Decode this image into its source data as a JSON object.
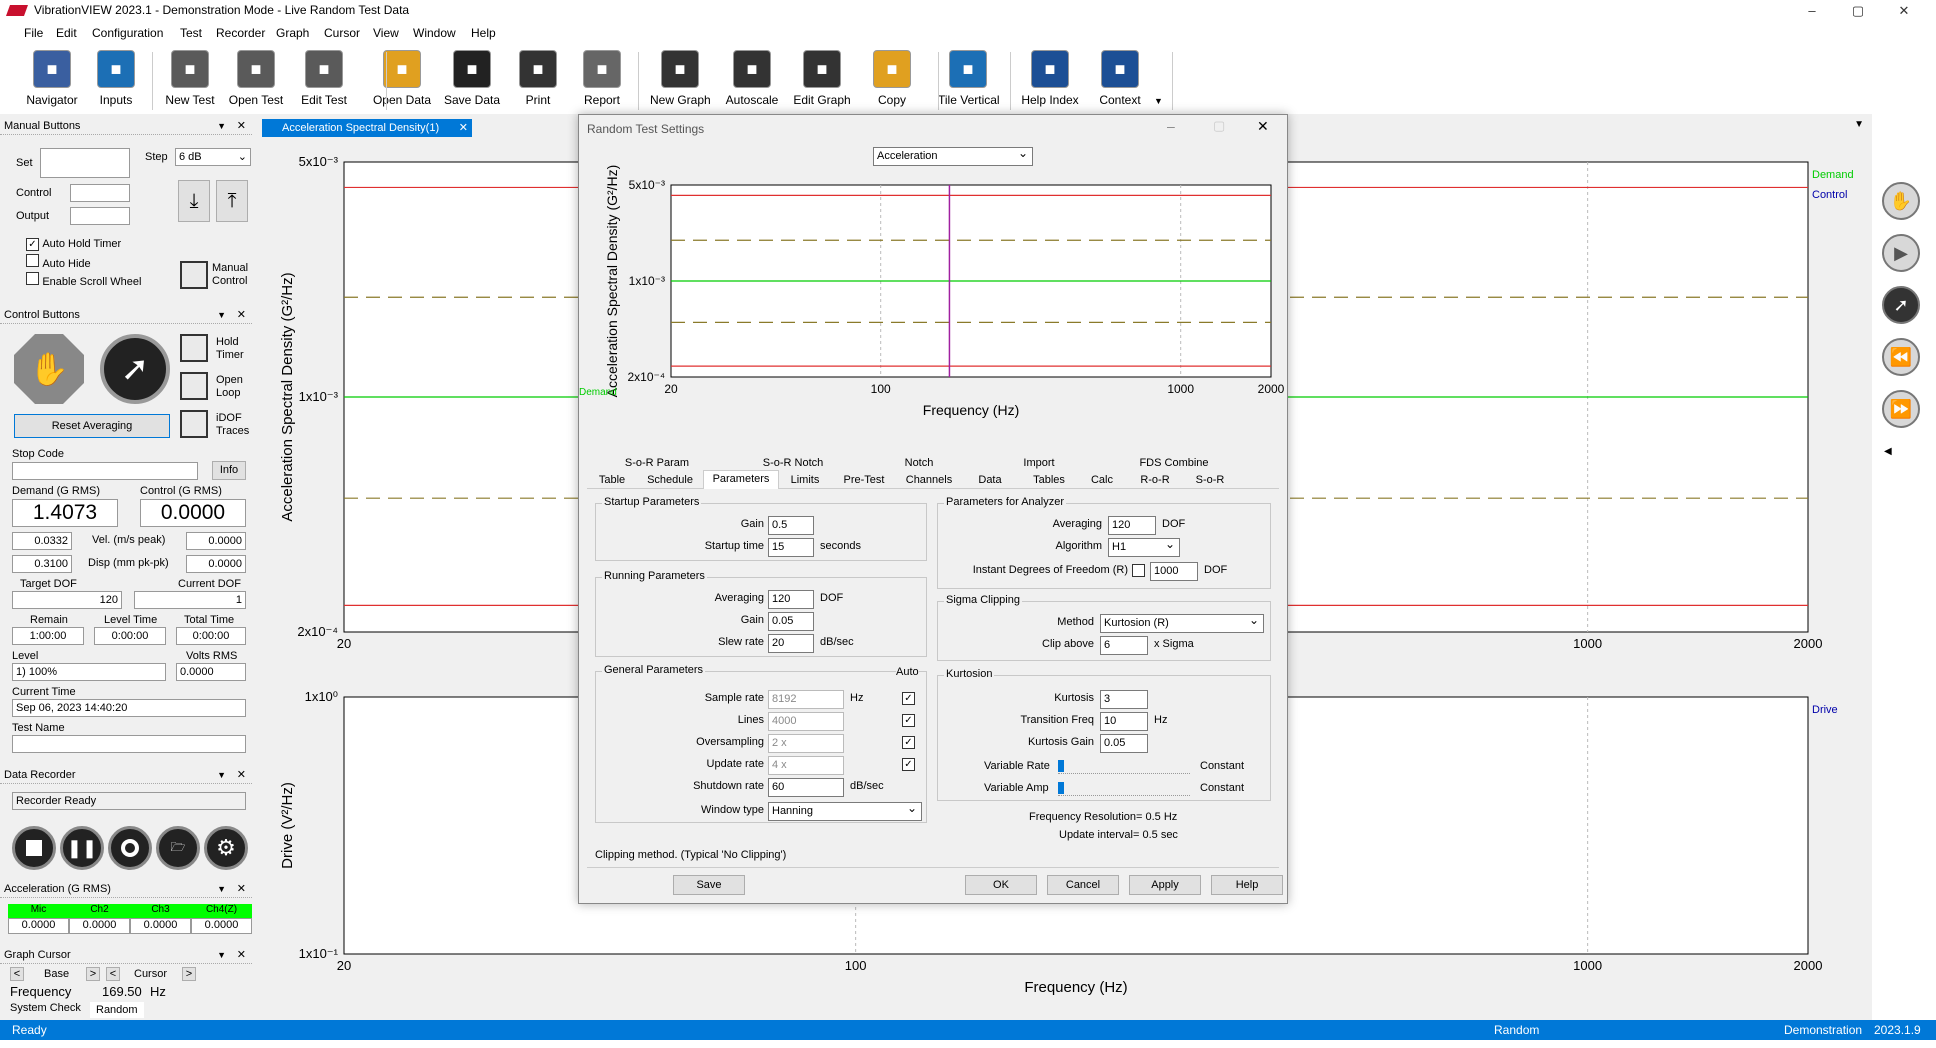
{
  "window": {
    "title": "VibrationVIEW 2023.1 - Demonstration Mode - Live Random Test Data",
    "min": "–",
    "max": "▢",
    "close": "✕"
  },
  "menu": [
    "File",
    "Edit",
    "Configuration",
    "Test",
    "Recorder",
    "Graph",
    "Cursor",
    "View",
    "Window",
    "Help"
  ],
  "toolbar": [
    {
      "label": "Navigator",
      "icon": "navigator-icon",
      "color": "#3a5fa0"
    },
    {
      "label": "Inputs",
      "icon": "inputs-icon",
      "color": "#1c6fb5"
    },
    {
      "label": "New Test",
      "icon": "gear-plus-icon",
      "color": "#5a5a5a"
    },
    {
      "label": "Open Test",
      "icon": "gear-open-icon",
      "color": "#5a5a5a"
    },
    {
      "label": "Edit Test",
      "icon": "gear-edit-icon",
      "color": "#5a5a5a"
    },
    {
      "label": "Open Data",
      "icon": "folder-icon",
      "color": "#e0a020"
    },
    {
      "label": "Save Data",
      "icon": "floppy-icon",
      "color": "#222"
    },
    {
      "label": "Print",
      "icon": "printer-icon",
      "color": "#333"
    },
    {
      "label": "Report",
      "icon": "report-icon",
      "color": "#666"
    },
    {
      "label": "New Graph",
      "icon": "new-graph-icon",
      "color": "#333"
    },
    {
      "label": "Autoscale",
      "icon": "autoscale-icon",
      "color": "#333"
    },
    {
      "label": "Edit Graph",
      "icon": "edit-graph-icon",
      "color": "#333"
    },
    {
      "label": "Copy",
      "icon": "copy-icon",
      "color": "#e0a020"
    },
    {
      "label": "Tile Vertical",
      "icon": "tile-vertical-icon",
      "color": "#1c6fb5"
    },
    {
      "label": "Help Index",
      "icon": "help-icon",
      "color": "#1c4f95"
    },
    {
      "label": "Context",
      "icon": "context-help-icon",
      "color": "#1c4f95"
    }
  ],
  "manual": {
    "header": "Manual Buttons",
    "set_label": "Set",
    "step_label": "Step",
    "step_value": "6 dB",
    "control_label": "Control",
    "output_label": "Output",
    "auto_hold": "Auto Hold Timer",
    "auto_hide": "Auto Hide",
    "scroll_wheel": "Enable Scroll Wheel",
    "manual_control": "Manual Control"
  },
  "control": {
    "header": "Control Buttons",
    "hold_timer": "Hold Timer",
    "open_loop": "Open Loop",
    "idof": "iDOF Traces",
    "reset": "Reset Averaging",
    "stop_code": "Stop Code",
    "info": "Info",
    "demand_label": "Demand (G RMS)",
    "control_label": "Control (G RMS)",
    "demand_value": "1.4073",
    "control_value": "0.0000",
    "v1": "0.0332",
    "vel_label": "Vel. (m/s peak)",
    "vel_value": "0.0000",
    "v2": "0.3100",
    "disp_label": "Disp (mm pk-pk)",
    "disp_value": "0.0000",
    "target_dof_label": "Target DOF",
    "current_dof_label": "Current DOF",
    "target_dof": "120",
    "current_dof": "1",
    "remain_label": "Remain",
    "level_time_label": "Level Time",
    "total_time_label": "Total Time",
    "remain": "1:00:00",
    "level_time": "0:00:00",
    "total_time": "0:00:00",
    "level_label": "Level",
    "volts_label": "Volts RMS",
    "level": "1) 100%",
    "volts": "0.0000",
    "current_time_label": "Current Time",
    "current_time": "Sep 06, 2023 14:40:20",
    "test_name_label": "Test Name"
  },
  "recorder": {
    "header": "Data Recorder",
    "status": "Recorder Ready"
  },
  "accel": {
    "header": "Acceleration (G RMS)",
    "channels": [
      "Mic",
      "Ch2",
      "Ch3",
      "Ch4(Z)"
    ],
    "values": [
      "0.0000",
      "0.0000",
      "0.0000",
      "0.0000"
    ]
  },
  "cursor": {
    "header": "Graph Cursor",
    "base": "Base",
    "cursor": "Cursor",
    "freq_label": "Frequency",
    "freq_value": "169.50",
    "freq_unit": "Hz"
  },
  "bottom_tabs": [
    "System Check",
    "Random"
  ],
  "graph_tab": "Acceleration Spectral Density(1)",
  "main_chart": {
    "ylabel": "Acceleration Spectral Density (G²/Hz)",
    "yticks": [
      "5x10⁻³",
      "1x10⁻³",
      "2x10⁻⁴"
    ],
    "xticks": [
      "20",
      "100",
      "1000",
      "2000"
    ],
    "legend": [
      "Demand",
      "Control"
    ],
    "legend_colors": [
      "#00cc00",
      "#0000aa"
    ]
  },
  "drive_chart": {
    "ylabel": "Drive (V²/Hz)",
    "xlabel": "Frequency (Hz)",
    "yticks": [
      "1x10⁰",
      "1x10⁻¹"
    ],
    "xticks": [
      "20",
      "100",
      "1000",
      "2000"
    ],
    "legend": [
      "Drive"
    ]
  },
  "chart_data": [
    {
      "type": "line",
      "title": "",
      "xlabel": "Frequency (Hz)",
      "ylabel": "Acceleration Spectral Density (G²/Hz)",
      "x_scale": "log",
      "y_scale": "log",
      "xlim": [
        20,
        2000
      ],
      "ylim": [
        0.0002,
        0.005
      ],
      "series": [
        {
          "name": "Demand",
          "color": "#00cc00",
          "x": [
            20,
            2000
          ],
          "y": [
            0.001,
            0.001
          ]
        },
        {
          "color": "#e03030",
          "x": [
            20,
            2000
          ],
          "y": [
            0.0042,
            0.0042
          ]
        },
        {
          "color": "#e03030",
          "x": [
            20,
            2000
          ],
          "y": [
            0.00024,
            0.00024
          ]
        },
        {
          "color": "#8a7a2a",
          "x": [
            20,
            2000
          ],
          "y": [
            0.00198,
            0.00198
          ]
        },
        {
          "color": "#8a7a2a",
          "x": [
            20,
            2000
          ],
          "y": [
            0.0005,
            0.0005
          ]
        }
      ]
    },
    {
      "type": "line",
      "title": "",
      "xlabel": "Frequency (Hz)",
      "ylabel": "Drive (V²/Hz)",
      "x_scale": "log",
      "y_scale": "log",
      "xlim": [
        20,
        2000
      ],
      "ylim": [
        0.1,
        1
      ],
      "series": []
    }
  ],
  "dialog": {
    "title": "Random Test Settings",
    "combo": "Acceleration",
    "chart_ylabel": "Acceleration Spectral Density (G²/Hz)",
    "chart_xlabel": "Frequency (Hz)",
    "yticks": [
      "5x10⁻³",
      "1x10⁻³",
      "2x10⁻⁴"
    ],
    "xticks": [
      "20",
      "100",
      "1000",
      "2000"
    ],
    "demand": "Demand",
    "tabs_top": [
      "S-o-R Param",
      "S-o-R Notch",
      "Notch",
      "Import",
      "FDS Combine"
    ],
    "tabs_bottom": [
      "Table",
      "Schedule",
      "Parameters",
      "Limits",
      "Pre-Test",
      "Channels",
      "Data",
      "Tables",
      "Calc",
      "R-o-R",
      "S-o-R"
    ],
    "startup": {
      "title": "Startup Parameters",
      "gain_label": "Gain",
      "gain": "0.5",
      "time_label": "Startup time",
      "time": "15",
      "time_unit": "seconds"
    },
    "running": {
      "title": "Running Parameters",
      "avg_label": "Averaging",
      "avg": "120",
      "avg_unit": "DOF",
      "gain_label": "Gain",
      "gain": "0.05",
      "slew_label": "Slew rate",
      "slew": "20",
      "slew_unit": "dB/sec"
    },
    "general": {
      "title": "General Parameters",
      "auto": "Auto",
      "sample_label": "Sample rate",
      "sample": "8192",
      "sample_unit": "Hz",
      "lines_label": "Lines",
      "lines": "4000",
      "over_label": "Oversampling",
      "over": "2 x",
      "update_label": "Update rate",
      "update": "4 x",
      "shutdown_label": "Shutdown rate",
      "shutdown": "60",
      "shutdown_unit": "dB/sec",
      "window_label": "Window type",
      "window": "Hanning"
    },
    "analyzer": {
      "title": "Parameters for Analyzer",
      "avg_label": "Averaging",
      "avg": "120",
      "avg_unit": "DOF",
      "alg_label": "Algorithm",
      "alg": "H1",
      "idof_label": "Instant Degrees of Freedom (R)",
      "idof": "1000",
      "idof_unit": "DOF"
    },
    "sigma": {
      "title": "Sigma Clipping",
      "method_label": "Method",
      "method": "Kurtosion (R)",
      "clip_label": "Clip above",
      "clip": "6",
      "clip_unit": "x Sigma"
    },
    "kurtosion": {
      "title": "Kurtosion",
      "kurt_label": "Kurtosis",
      "kurt": "3",
      "trans_label": "Transition Freq",
      "trans": "10",
      "trans_unit": "Hz",
      "kgain_label": "Kurtosis Gain",
      "kgain": "0.05",
      "vrate_label": "Variable Rate",
      "vamp_label": "Variable Amp",
      "constant": "Constant"
    },
    "freq_res": "Frequency Resolution= 0.5 Hz",
    "update_int": "Update interval= 0.5 sec",
    "clipping": "Clipping method. (Typical 'No Clipping')",
    "buttons": {
      "save": "Save",
      "ok": "OK",
      "cancel": "Cancel",
      "apply": "Apply",
      "help": "Help"
    }
  },
  "status": {
    "left": "Ready",
    "mid": "Random",
    "mode": "Demonstration",
    "version": "2023.1.9"
  }
}
